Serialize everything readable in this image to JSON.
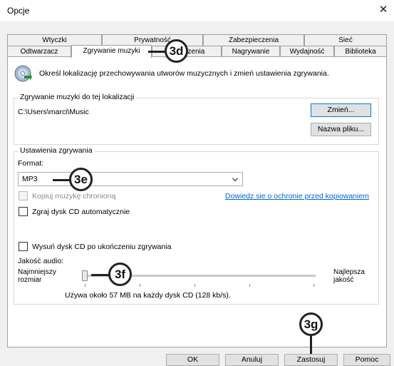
{
  "window": {
    "title": "Opcje",
    "close_glyph": "✕"
  },
  "tabs_row1": [
    {
      "label": "Wtyczki"
    },
    {
      "label": "Prywatność"
    },
    {
      "label": "Zabezpieczenia"
    },
    {
      "label": "Sieć"
    }
  ],
  "tabs_row2": [
    {
      "label": "Odtwarzacz"
    },
    {
      "label": "Zgrywanie muzyki",
      "active": true
    },
    {
      "label": "Urządzenia"
    },
    {
      "label": "Nagrywanie"
    },
    {
      "label": "Wydajność"
    },
    {
      "label": "Biblioteka"
    }
  ],
  "header": {
    "icon": "cd-rip-icon",
    "description": "Określ lokalizację przechowywania utworów muzycznych i zmień ustawienia zgrywania."
  },
  "location_group": {
    "title": "Zgrywanie muzyki do tej lokalizacji",
    "path": "C:\\Users\\marci\\Music",
    "change_button": "Zmień...",
    "filename_button": "Nazwa pliku..."
  },
  "settings_group": {
    "title": "Ustawienia zgrywania",
    "format_label": "Format:",
    "format_value": "MP3",
    "copy_protect_label": "Kopiuj muzykę chronioną",
    "copy_protect_checked": false,
    "copy_protect_enabled": false,
    "learn_link": "Dowiedz sie o ochronie przed kopiowaniem",
    "auto_rip_label": "Zgraj dysk CD automatycznie",
    "auto_rip_checked": false,
    "eject_label": "Wysuń dysk CD po ukończeniu zgrywania",
    "eject_checked": false,
    "quality_label": "Jakość audio:",
    "quality_min_label_1": "Najmniejszy",
    "quality_min_label_2": "rozmiar",
    "quality_max_label_1": "Najlepsza",
    "quality_max_label_2": "jakość",
    "quality_level": 0,
    "quality_note": "Używa około 57 MB na każdy dysk CD (128 kb/s)."
  },
  "footer": {
    "ok": "OK",
    "cancel": "Anuluj",
    "apply": "Zastosuj",
    "help": "Pomoc"
  },
  "callouts": {
    "tab": "3d",
    "format": "3e",
    "quality": "3f",
    "apply": "3g"
  }
}
